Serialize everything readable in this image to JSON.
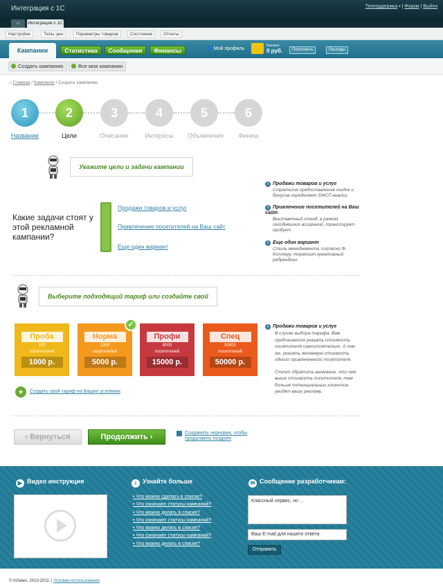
{
  "app": {
    "title": "Интеграция с 1С",
    "links": [
      "Техподдержка",
      "Форум",
      "Выйти"
    ]
  },
  "tabs": {
    "home": "⌂",
    "active": "Интеграция с 1С"
  },
  "subnav": [
    "Настройки",
    "Типы цен",
    "Параметры товаров",
    "Состояние",
    "Отчеты"
  ],
  "mainnav": {
    "campaigns": "Кампании",
    "stats": "Статистика",
    "messages": "Сообщения",
    "finance": "Финансы",
    "profile": "Мой профиль",
    "balance_label": "Баланс:",
    "balance": "0 руб.",
    "topup": "Пополнить",
    "expenses": "Расходы"
  },
  "actions": {
    "create": "Создать кампанию",
    "all": "Все мои кампании"
  },
  "breadcrumbs": {
    "home": "Главная",
    "campaigns": "Кампании",
    "current": "Создать кампанию"
  },
  "steps": [
    {
      "num": "1",
      "label": "Название"
    },
    {
      "num": "2",
      "label": "Цели"
    },
    {
      "num": "3",
      "label": "Описание"
    },
    {
      "num": "4",
      "label": "Интересы"
    },
    {
      "num": "5",
      "label": "Объявления"
    },
    {
      "num": "6",
      "label": "Финиш"
    }
  ],
  "goals": {
    "bubble": "Укажите цели и задачи кампании",
    "question": "Какие задачи стоят у этой рекламной кампании?",
    "options": [
      "Продажи товаров и услуг",
      "Привлечение посетителей на Ваш сайт",
      "Еще один вариант"
    ],
    "info": [
      {
        "title": "Продажи товаров и услуг",
        "text": "Стратегия предоставления скидок и бонусов определяет SWOT-анализ"
      },
      {
        "title": "Привлечение посетителей на Ваш сайт",
        "text": "Выставочный стенд, в рамках сегодняшних воззрений, транслирует продукт"
      },
      {
        "title": "Еще один вариант",
        "text": "Стиль менеджмента, согласно Ф. Котлеру, тормозит креативный ребрендинг"
      }
    ]
  },
  "tariffs": {
    "bubble": "Выберите подходящий тариф или создайте свой",
    "items": [
      {
        "name": "Проба",
        "visits": "100",
        "unit": "посетителей",
        "price": "1000 р.",
        "color": "#f0b81a"
      },
      {
        "name": "Норма",
        "visits": "1000",
        "unit": "посетителей",
        "price": "5000 р.",
        "color": "#f39a1e"
      },
      {
        "name": "Профи",
        "visits": "8000",
        "unit": "посетителей",
        "price": "15000 р.",
        "color": "#c63a3f"
      },
      {
        "name": "Спец",
        "visits": "50000",
        "unit": "посетителей",
        "price": "50000 р.",
        "color": "#ea5a1c"
      }
    ],
    "own": "Создать свой тариф на Ваших условиях",
    "info_title": "Продажи товаров и услуг",
    "info_p1": "В случае выбора тарифа, Вам предлагается указать стоимость посетителя самостоятельно. А так же, указать желаемую стоимость одного привлеченного посетителя.",
    "info_p2": "Стоит обратить внимание, что чем выше стоимость посетителя, тем больше потенциальных клиентов увидят вашу рекламу."
  },
  "buttons": {
    "back": "Вернуться",
    "next": "Продолжить",
    "save": "Сохранить черновик, чтобы продолжить позднее"
  },
  "footer": {
    "video_title": "Видео инструкция",
    "more_title": "Узнайте больше",
    "more_links": [
      "Что можно сделать в списке?",
      "Что означают статусы кампаний?",
      "Что можно делать в списке?",
      "Что означают статусы кампаний?",
      "Что можно делать в списке?",
      "Что означают статусы кампаний?",
      "Что можно делать в списке?"
    ],
    "msg_title": "Сообщение разработчикам:",
    "msg_value": "Классный сервис, но ...",
    "email_value": "Ваш E-mail для нашего ответа",
    "send": "Отправить"
  },
  "copyright": {
    "text": "© InSales, 2010-2011.",
    "link": "Условия использования"
  }
}
